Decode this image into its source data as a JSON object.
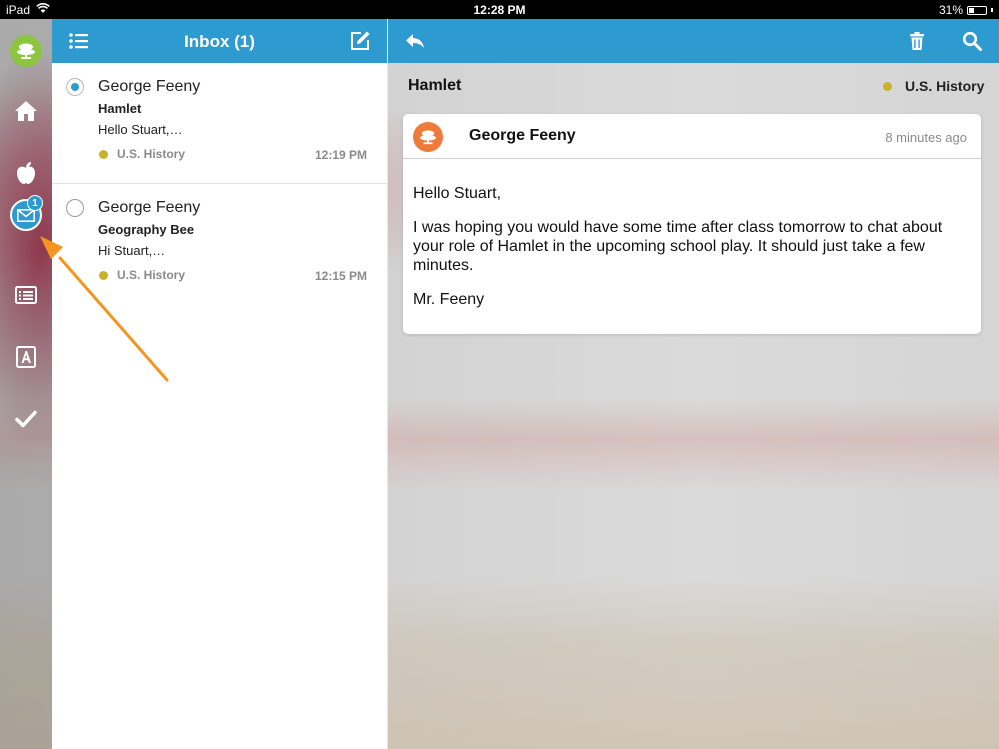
{
  "status_bar": {
    "device": "iPad",
    "time": "12:28 PM",
    "battery": "31%",
    "battery_level": 0.31
  },
  "rail": {
    "mail_badge": "1"
  },
  "inbox": {
    "title": "Inbox (1)",
    "messages": [
      {
        "sender": "George Feeny",
        "subject": "Hamlet",
        "preview": "Hello Stuart,…",
        "tag": "U.S. History",
        "time": "12:19 PM",
        "selected": true
      },
      {
        "sender": "George Feeny",
        "subject": "Geography Bee",
        "preview": "Hi Stuart,…",
        "tag": "U.S. History",
        "time": "12:15 PM",
        "selected": false
      }
    ]
  },
  "reader": {
    "subject": "Hamlet",
    "tag": "U.S. History",
    "message": {
      "sender": "George Feeny",
      "time": "8 minutes ago",
      "greeting": "Hello Stuart,",
      "body": "I was hoping you would have some time after class tomorrow to chat about your role of Hamlet in the upcoming school play. It should just take a few minutes.",
      "signature": "Mr. Feeny"
    }
  },
  "colors": {
    "accent": "#2e9bd0",
    "tag_dot": "#c8b22c",
    "logo_green": "#8cc63f",
    "avatar_orange": "#ef7b3b",
    "annotation_arrow": "#f7941d"
  }
}
